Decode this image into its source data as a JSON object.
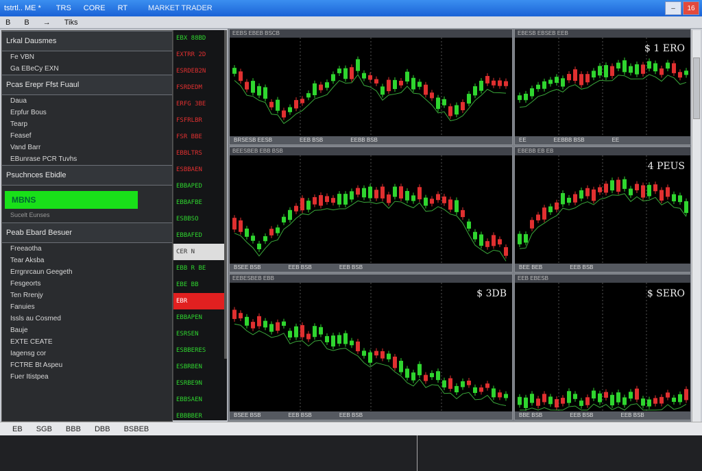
{
  "titlebar": {
    "app": "tstrtl.. ME *",
    "tabs": [
      "TRS",
      "CORE",
      "RT"
    ],
    "title": "MARKET TRADER",
    "btn_min": "–",
    "btn_close": "16"
  },
  "menubar": {
    "items": [
      "B",
      "B",
      "→",
      "Tiks"
    ]
  },
  "left": {
    "sec1_head": "Lrkal Dausmes",
    "sec1_items": [
      "Fe VBN",
      "Ga EBeCy EXN"
    ],
    "sec2_head": "Pcas Erepr Ffst Fuaul",
    "sec2_items": [
      "Daua",
      "Erpfur Bous",
      "Tearp",
      "Feasef",
      "Vand Barr",
      "EBunrase PCR Tuvhs"
    ],
    "sec3_head": "Psuchnces Ebidle",
    "green_label": "MBNS",
    "green_note": "Sucelt Eunses",
    "sec4_head": "Peab Ebard Besuer",
    "sec4_items": [
      "Freeaotha",
      "Tear Aksba",
      "Errgnrcaun Geegeth",
      "Fesgeorts",
      "Ten Rrenjy",
      "Fanuies",
      "Issls au Cosmed",
      "Bauje",
      "EXTE CEATE",
      "Iagensg cor",
      "FCTRE Bt Aspeu",
      "Fuer Itistpea"
    ]
  },
  "tickers": [
    {
      "t": "EBX 88BD",
      "c": "g"
    },
    {
      "t": "EXTRR 2D",
      "c": "r"
    },
    {
      "t": "ESRDEB2N",
      "c": "r"
    },
    {
      "t": "FSRDEDM",
      "c": "r"
    },
    {
      "t": "ERFG 3BE",
      "c": "r"
    },
    {
      "t": "FSFRLBR",
      "c": "r"
    },
    {
      "t": "FSR BBE",
      "c": "r"
    },
    {
      "t": "EBBLTRS",
      "c": "r"
    },
    {
      "t": "ESBBAEN",
      "c": "r"
    },
    {
      "t": "EBBAPED",
      "c": "g"
    },
    {
      "t": "EBBAFBE",
      "c": "g"
    },
    {
      "t": "ESBBSO",
      "c": "g"
    },
    {
      "t": "EBBAFED",
      "c": "g"
    },
    {
      "t": "CER N",
      "c": "hw"
    },
    {
      "t": "EBB R BE",
      "c": "g"
    },
    {
      "t": "EBE BB",
      "c": "g"
    },
    {
      "t": "EBR",
      "c": "hl"
    },
    {
      "t": "EBBAPEN",
      "c": "g"
    },
    {
      "t": "ESRSEN",
      "c": "g"
    },
    {
      "t": "ESBBERES",
      "c": "g"
    },
    {
      "t": "ESBRBEN",
      "c": "g"
    },
    {
      "t": "ESRBE9N",
      "c": "g"
    },
    {
      "t": "EBBSAEN",
      "c": "g"
    },
    {
      "t": "EBBBBER",
      "c": "g"
    }
  ],
  "charts": [
    {
      "hdr": "EEBS EBEB BSCB",
      "price": "",
      "foot": [
        "BRSESB EESB",
        "EEB BSB",
        "EEBB BSB"
      ]
    },
    {
      "hdr": "EBESB EBSEB EEB",
      "price": "$ 1 ERO",
      "foot": [
        "EE",
        "EEBBB BSB",
        "EE"
      ]
    },
    {
      "hdr": "BEESBEB EBB BSB",
      "price": "",
      "foot": [
        "BSEE BSB",
        "EEB BSB",
        "EEB BSB"
      ]
    },
    {
      "hdr": "EBEBB EB EB",
      "price": "4 PEUS",
      "foot": [
        "BEE BEB",
        "EEB BSB"
      ]
    },
    {
      "hdr": "EEBESBEB EBB",
      "price": "$ 3DB",
      "foot": [
        "BSEE BSB",
        "EEB BSB",
        "EEB BSB"
      ]
    },
    {
      "hdr": "EEB EBESB",
      "price": "$ SERO",
      "foot": [
        "BBE BSB",
        "EEB BSB",
        "EEB BSB"
      ]
    }
  ],
  "status": {
    "items": [
      "EB",
      "SGB",
      "BBB",
      "DBB",
      "BSBEB"
    ]
  },
  "colors": {
    "up": "#2fd52f",
    "down": "#e03030",
    "bg": "#000000",
    "accent": "#19e019"
  }
}
